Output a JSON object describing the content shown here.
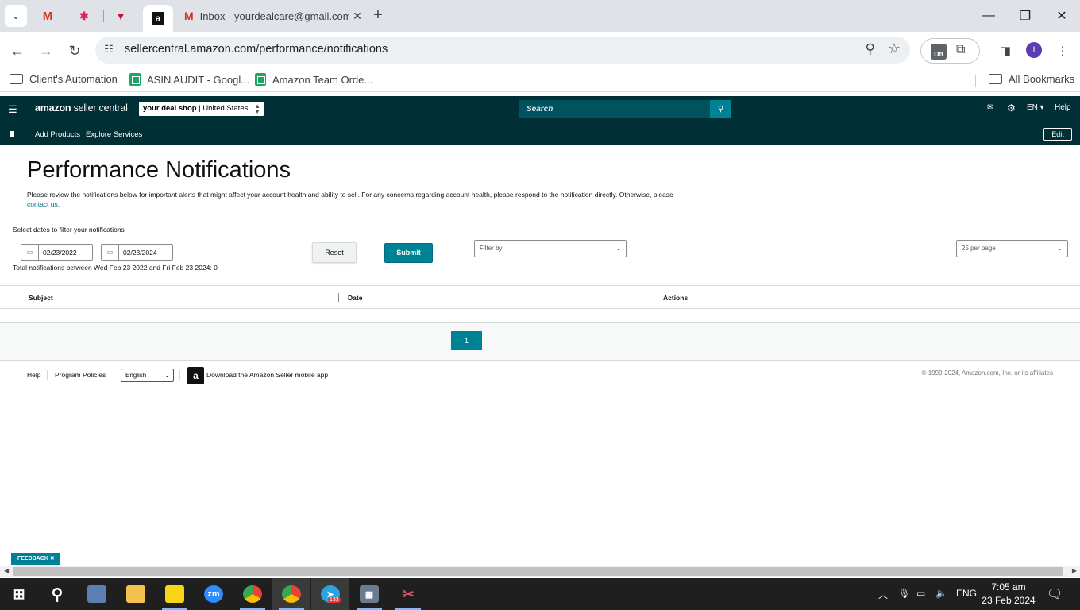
{
  "browser": {
    "tabs": [
      {
        "label": "Inbox - yourdealcare@gmail.com"
      }
    ],
    "url": "sellercentral.amazon.com/performance/notifications",
    "ext_off_label": "Off",
    "profile_initial": "I",
    "bookmarks": [
      {
        "label": "Client's Automation"
      },
      {
        "label": "ASIN AUDIT - Googl..."
      },
      {
        "label": "Amazon Team Orde..."
      },
      {
        "label": "All Bookmarks"
      }
    ]
  },
  "header": {
    "logo_amazon": "amazon",
    "logo_rest": " seller central",
    "account_store": "your deal shop",
    "account_region": "| United States",
    "search_placeholder": "Search",
    "language": "EN",
    "help": "Help",
    "subnav": [
      {
        "label": "Add Products"
      },
      {
        "label": "Explore Services"
      }
    ],
    "edit": "Edit"
  },
  "main": {
    "title": "Performance Notifications",
    "intro": "Please review the notifications below for important alerts that might affect your account health and ability to sell. For any concerns regarding account health, please respond to the notification directly. Otherwise, please",
    "contact_link": "contact us.",
    "filter_label": "Select dates to filter your notifications",
    "start_date": "02/23/2022",
    "end_date": "02/23/2024",
    "reset": "Reset",
    "submit": "Submit",
    "filter_by": "Filter by",
    "per_page": "25 per page",
    "total_text": "Total notifications between Wed Feb 23 2022 and Fri Feb 23 2024: 0",
    "columns": [
      "Subject",
      "Date",
      "Actions"
    ],
    "page": "1"
  },
  "footer": {
    "help": "Help",
    "policies": "Program Policies",
    "language": "English",
    "app_text": "Download the Amazon Seller mobile app",
    "copyright": "© 1999-2024, Amazon.com, Inc. or its affiliates"
  },
  "feedback": "FEEDBACK",
  "feedback_close": "✕",
  "taskbar": {
    "telegram_badge": "133",
    "lang": "ENG",
    "time": "7:05 am",
    "date": "23 Feb 2024"
  },
  "colors": {
    "header_bg": "#002f36",
    "accent": "#008296"
  }
}
